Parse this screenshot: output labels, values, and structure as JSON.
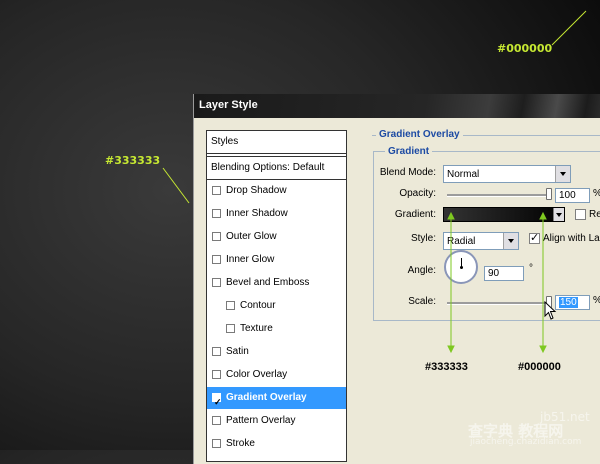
{
  "annotations": {
    "top_right_color": "#000000",
    "left_color": "#333333",
    "bottom_left_color": "#333333",
    "bottom_right_color": "#000000",
    "accent": "#c6e832"
  },
  "dialog": {
    "title": "Layer Style",
    "left_panel": {
      "styles_header": "Styles",
      "blending_options": "Blending Options: Default",
      "items": [
        {
          "label": "Drop Shadow",
          "checked": false,
          "indent": false,
          "selected": false
        },
        {
          "label": "Inner Shadow",
          "checked": false,
          "indent": false,
          "selected": false
        },
        {
          "label": "Outer Glow",
          "checked": false,
          "indent": false,
          "selected": false
        },
        {
          "label": "Inner Glow",
          "checked": false,
          "indent": false,
          "selected": false
        },
        {
          "label": "Bevel and Emboss",
          "checked": false,
          "indent": false,
          "selected": false
        },
        {
          "label": "Contour",
          "checked": false,
          "indent": true,
          "selected": false
        },
        {
          "label": "Texture",
          "checked": false,
          "indent": true,
          "selected": false
        },
        {
          "label": "Satin",
          "checked": false,
          "indent": false,
          "selected": false
        },
        {
          "label": "Color Overlay",
          "checked": false,
          "indent": false,
          "selected": false
        },
        {
          "label": "Gradient Overlay",
          "checked": true,
          "indent": false,
          "selected": true
        },
        {
          "label": "Pattern Overlay",
          "checked": false,
          "indent": false,
          "selected": false
        },
        {
          "label": "Stroke",
          "checked": false,
          "indent": false,
          "selected": false
        }
      ]
    },
    "gradient_overlay": {
      "section_title": "Gradient Overlay",
      "group_title": "Gradient",
      "blend_mode_label": "Blend Mode:",
      "blend_mode_value": "Normal",
      "opacity_label": "Opacity:",
      "opacity_value": "100",
      "opacity_unit": "%",
      "opacity_level": 1.0,
      "gradient_label": "Gradient:",
      "gradient_colors": [
        "#333333",
        "#000000"
      ],
      "reverse_label": "Re",
      "reverse_checked": false,
      "style_label": "Style:",
      "style_value": "Radial",
      "align_label": "Align with La",
      "align_checked": true,
      "angle_label": "Angle:",
      "angle_value": "90",
      "angle_unit": "°",
      "scale_label": "Scale:",
      "scale_value": "150",
      "scale_unit": "%",
      "scale_level": 1.0
    }
  },
  "watermark": {
    "line1": "jb51.net",
    "line2": "查字典 教程网",
    "line3": "jiaocheng.chazidian.com"
  }
}
